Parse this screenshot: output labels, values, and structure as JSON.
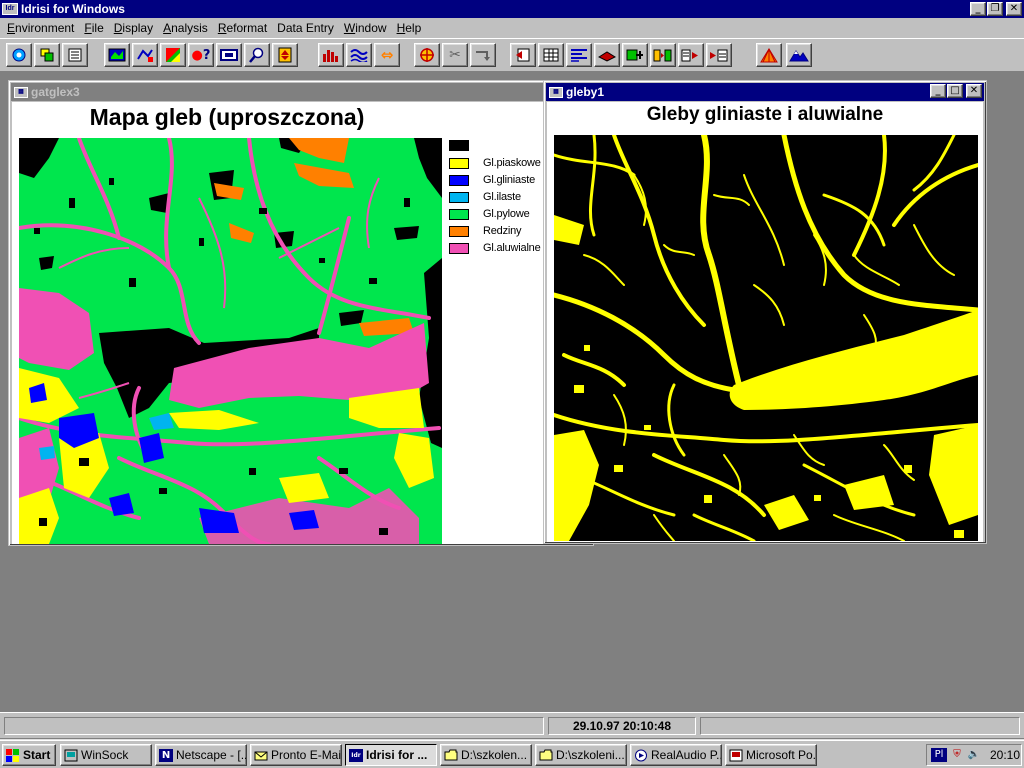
{
  "app": {
    "title": "Idrisi for Windows",
    "icon": "idrisi-logo-icon"
  },
  "menu": [
    {
      "label": "Environment",
      "u": "E",
      "rest": "nvironment"
    },
    {
      "label": "File",
      "u": "F",
      "rest": "ile"
    },
    {
      "label": "Display",
      "u": "D",
      "rest": "isplay"
    },
    {
      "label": "Analysis",
      "u": "A",
      "rest": "nalysis"
    },
    {
      "label": "Reformat",
      "u": "R",
      "rest": "eformat"
    },
    {
      "label": "Data Entry",
      "u": "",
      "rest": "Data Entry"
    },
    {
      "label": "Window",
      "u": "W",
      "rest": "indow"
    },
    {
      "label": "Help",
      "u": "H",
      "rest": "elp"
    }
  ],
  "toolbar_icons": [
    "globe-icon",
    "windows-icon",
    "list-icon",
    "map-icon",
    "vector-icon",
    "palette-icon",
    "query-icon",
    "frame-icon",
    "zoom-icon",
    "stack-icon",
    "histogram-icon",
    "waves-icon",
    "swap-icon",
    "target-icon",
    "cross-icon",
    "arrow-icon",
    "export-icon",
    "table-icon",
    "lines-icon",
    "layer-icon",
    "add-icon",
    "compare-icon",
    "convert-icon",
    "import-icon",
    "terrain-icon",
    "mountain-icon"
  ],
  "window_left": {
    "title": "gatglex3",
    "map_title": "Mapa gleb (uproszczona)",
    "legend": [
      {
        "label": "",
        "color": "#000000"
      },
      {
        "label": "Gl.piaskowe",
        "color": "#ffff00"
      },
      {
        "label": "Gl.gliniaste",
        "color": "#0000ff"
      },
      {
        "label": "Gl.ilaste",
        "color": "#00b4f0"
      },
      {
        "label": "Gl.pylowe",
        "color": "#00e64d"
      },
      {
        "label": "Redziny",
        "color": "#ff8000"
      },
      {
        "label": "Gl.aluwialne",
        "color": "#f050b4"
      }
    ]
  },
  "window_right": {
    "title": "gleby1",
    "map_title": "Gleby gliniaste i aluwialne"
  },
  "status": {
    "datetime": "29.10.97 20:10:48"
  },
  "taskbar": {
    "start": "Start",
    "tasks": [
      {
        "label": "WinSock",
        "icon": "winsock-icon"
      },
      {
        "label": "Netscape - [...",
        "icon": "netscape-icon"
      },
      {
        "label": "Pronto E-Mail",
        "icon": "email-icon"
      },
      {
        "label": "Idrisi for ...",
        "icon": "idrisi-icon"
      },
      {
        "label": "D:\\szkolen...",
        "icon": "folder-icon"
      },
      {
        "label": "D:\\szkoleni...",
        "icon": "folder-icon"
      },
      {
        "label": "RealAudio P...",
        "icon": "realaudio-icon"
      },
      {
        "label": "Microsoft Po...",
        "icon": "powerpoint-icon"
      }
    ],
    "tray_lang": "Pl",
    "tray_time": "20:10"
  },
  "colors": {
    "titlebar_active": "#000080",
    "titlebar_inactive": "#808080",
    "desktop": "#808080"
  }
}
